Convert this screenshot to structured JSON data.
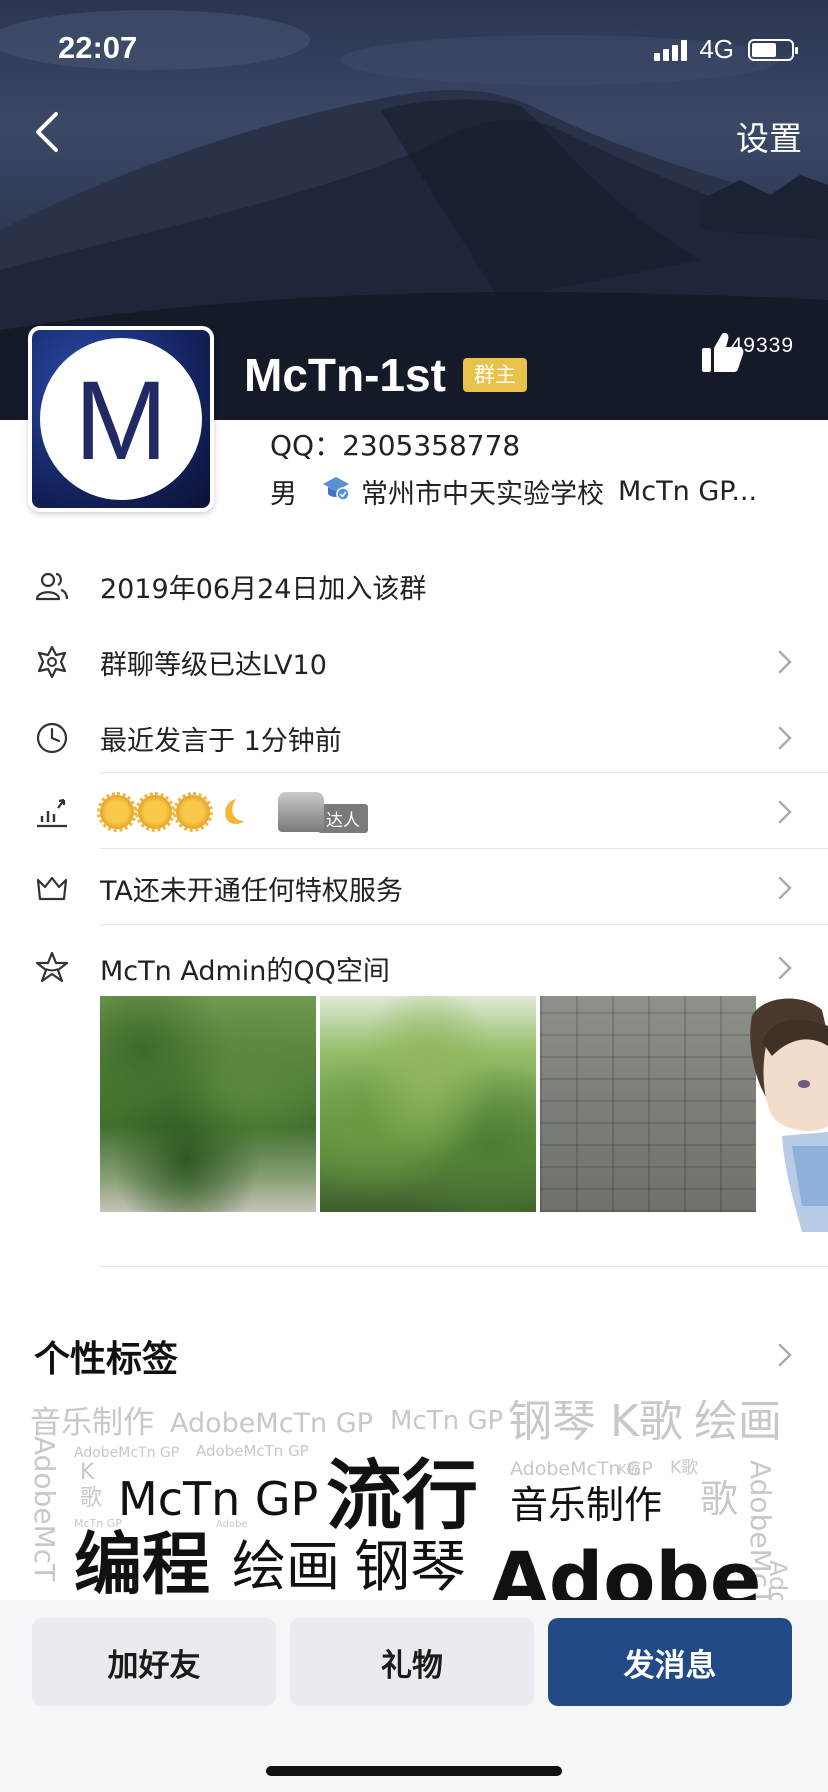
{
  "status_bar": {
    "time": "22:07",
    "network": "4G"
  },
  "header": {
    "settings_label": "设置",
    "name": "McTn-1st",
    "badge": "群主",
    "like_count": "149339",
    "avatar_letter": "M"
  },
  "profile": {
    "qq": "QQ：2305358778",
    "gender": "男",
    "school": "常州市中天实验学校",
    "group": "McTn GP..."
  },
  "rows": {
    "joined": "2019年06月24日加入该群",
    "level": "群聊等级已达LV10",
    "last_speak": "最近发言于 1分钟前",
    "talent_label": "达人",
    "privilege": "TA还未开通任何特权服务",
    "qzone": "McTn Admin的QQ空间"
  },
  "tags": {
    "title": "个性标签",
    "cloud": [
      "音乐制作",
      "AdobeMcTn GP",
      "McTn GP",
      "钢琴",
      "K歌",
      "绘画",
      "AdobeMcTn GP",
      "AdobeMcTn GP",
      "AdobeMcTn GP",
      "K歌",
      "K",
      "歌",
      "McTn GP",
      "流行",
      "音乐制作",
      "歌",
      "AdobeMcTn",
      "McTn GP",
      "编程",
      "绘画",
      "钢琴",
      "Adobe",
      "AdobeMcT",
      "AdobeM",
      "Adobe",
      "K歌"
    ]
  },
  "bottom": {
    "add_friend": "加好友",
    "gift": "礼物",
    "message": "发消息"
  },
  "colors": {
    "primary_button": "#224a87",
    "badge": "#e8c24a",
    "banner": "#2c3650"
  },
  "icons": [
    "back-icon",
    "thumb-up-icon",
    "graduation-icon",
    "group-icon",
    "star-badge-icon",
    "clock-icon",
    "chart-icon",
    "crown-icon",
    "star-space-icon",
    "chevron-right-icon"
  ]
}
